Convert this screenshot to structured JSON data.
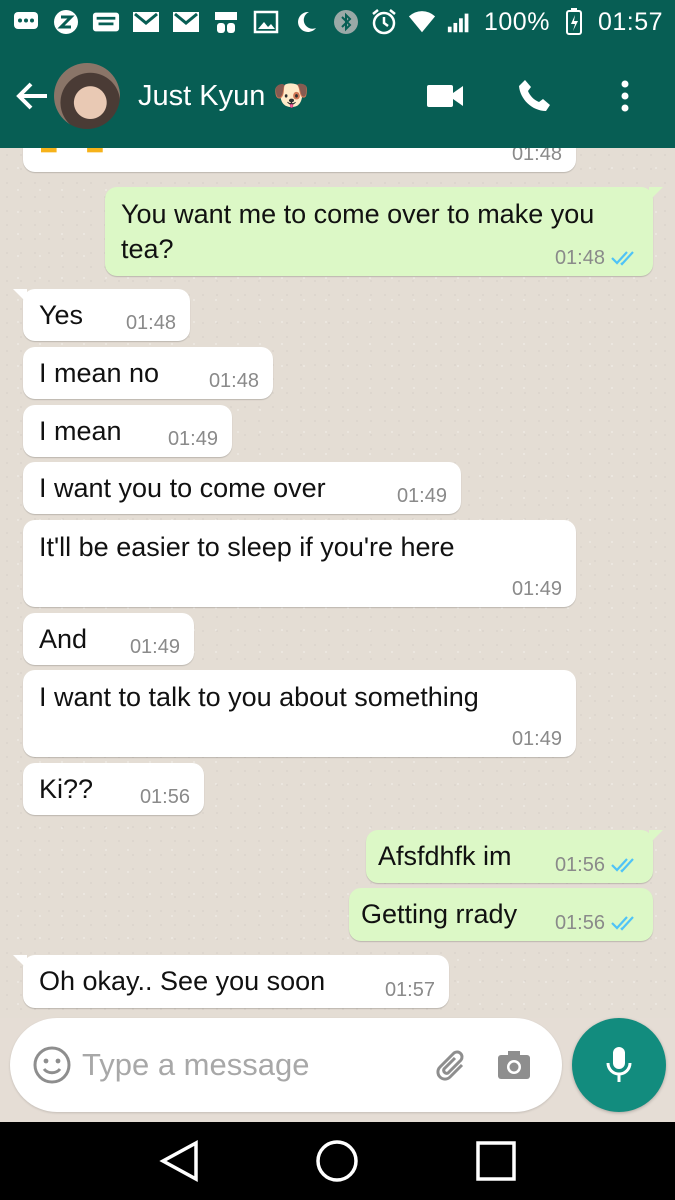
{
  "status_bar": {
    "battery": "100%",
    "time": "01:57",
    "icons": [
      "chat-icon",
      "z-app-icon",
      "webtoon-icon",
      "gmail-icon",
      "gmail-icon",
      "pedometer-icon",
      "gallery-icon",
      "moon-icon",
      "bluetooth-icon",
      "alarm-icon",
      "wifi-icon",
      "signal-icon",
      "battery-icon"
    ]
  },
  "header": {
    "contact_name": "Just Kyun",
    "name_emoji": "🐶"
  },
  "messages": [
    {
      "dir": "in",
      "text": "",
      "time": "01:48"
    },
    {
      "dir": "out",
      "text": "You want me to come over to make you tea?",
      "time": "01:48",
      "read": true
    },
    {
      "dir": "in",
      "text": "Yes",
      "time": "01:48"
    },
    {
      "dir": "in",
      "text": "I mean no",
      "time": "01:48"
    },
    {
      "dir": "in",
      "text": "I mean",
      "time": "01:49"
    },
    {
      "dir": "in",
      "text": "I want you to come over",
      "time": "01:49"
    },
    {
      "dir": "in",
      "text": "It'll be easier to sleep if you're here",
      "time": "01:49"
    },
    {
      "dir": "in",
      "text": "And",
      "time": "01:49"
    },
    {
      "dir": "in",
      "text": "I want to talk to you about something",
      "time": "01:49"
    },
    {
      "dir": "in",
      "text": "Ki??",
      "time": "01:56"
    },
    {
      "dir": "out",
      "text": "Afsfdhfk im",
      "time": "01:56",
      "read": true
    },
    {
      "dir": "out",
      "text": "Getting rrady",
      "time": "01:56",
      "read": true
    },
    {
      "dir": "in",
      "text": "Oh okay.. See you soon",
      "time": "01:57"
    }
  ],
  "composer": {
    "placeholder": "Type a message",
    "value": ""
  },
  "colors": {
    "header": "#075e54",
    "outgoing_bubble": "#dcf8c6",
    "incoming_bubble": "#ffffff",
    "read_ticks": "#4fc3f7",
    "mic_button": "#128c7e"
  }
}
